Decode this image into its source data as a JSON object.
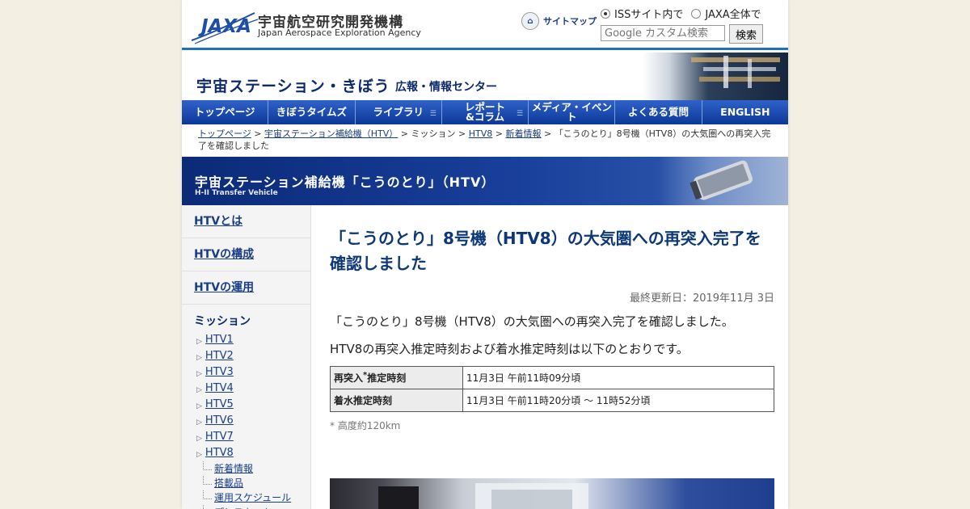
{
  "header": {
    "org_ja": "宇宙航空研究開発機構",
    "org_en": "Japan Aerospace Exploration Agency",
    "logo_text": "JAXA",
    "sitemap_label": "サイトマップ",
    "scope_iss": "ISSサイト内で",
    "scope_all": "JAXA全体で",
    "search_placeholder": "Google カスタム検索",
    "search_button": "検索"
  },
  "banner": {
    "title": "宇宙ステーション・きぼう",
    "subtitle": "広報・情報センター"
  },
  "nav": [
    {
      "label": "トップページ",
      "has_menu": false
    },
    {
      "label": "きぼうタイムズ",
      "has_menu": false
    },
    {
      "label": "ライブラリ",
      "has_menu": true
    },
    {
      "label": "レポート\n&コラム",
      "has_menu": true
    },
    {
      "label": "メディア・イベント",
      "has_menu": false
    },
    {
      "label": "よくある質問",
      "has_menu": false
    },
    {
      "label": "ENGLISH",
      "has_menu": false
    }
  ],
  "breadcrumb": {
    "items": [
      "トップページ",
      "宇宙ステーション補給機（HTV）",
      "ミッション",
      "HTV8",
      "新着情報"
    ],
    "links": [
      true,
      true,
      false,
      true,
      true
    ],
    "current": "「こうのとり」8号機（HTV8）の大気圏への再突入完了を確認しました"
  },
  "section": {
    "title": "宇宙ステーション補給機「こうのとり」（HTV）",
    "subtitle": "H-II Transfer Vehicle"
  },
  "sidebar": {
    "links": [
      "HTVとは",
      "HTVの構成",
      "HTVの運用"
    ],
    "mission_heading": "ミッション",
    "missions": [
      "HTV1",
      "HTV2",
      "HTV3",
      "HTV4",
      "HTV5",
      "HTV6",
      "HTV7",
      "HTV8"
    ],
    "htv8_sub": [
      "新着情報",
      "搭載品",
      "運用スケジュール",
      "プレスキット"
    ]
  },
  "article": {
    "title": "「こうのとり」8号機（HTV8）の大気圏への再突入完了を確認しました",
    "updated": "最終更新日：2019年11月 3日",
    "para1": "「こうのとり」8号機（HTV8）の大気圏への再突入完了を確認しました。",
    "para2": "HTV8の再突入推定時刻および着水推定時刻は以下のとおりです。",
    "table": [
      {
        "key": "再突入",
        "key_sup": "*",
        "key_rest": "推定時刻",
        "value": "11月3日 午前11時09分頃"
      },
      {
        "key": "着水推定時刻",
        "key_sup": "",
        "key_rest": "",
        "value": "11月3日 午前11時20分頃 ～ 11時52分頃"
      }
    ],
    "note": "* 高度約120km"
  },
  "colors": {
    "accent": "#1d6fc1",
    "nav": "#0c3898",
    "link": "#1a3e85",
    "heading": "#0d3877",
    "background": "#f3f0e3"
  }
}
